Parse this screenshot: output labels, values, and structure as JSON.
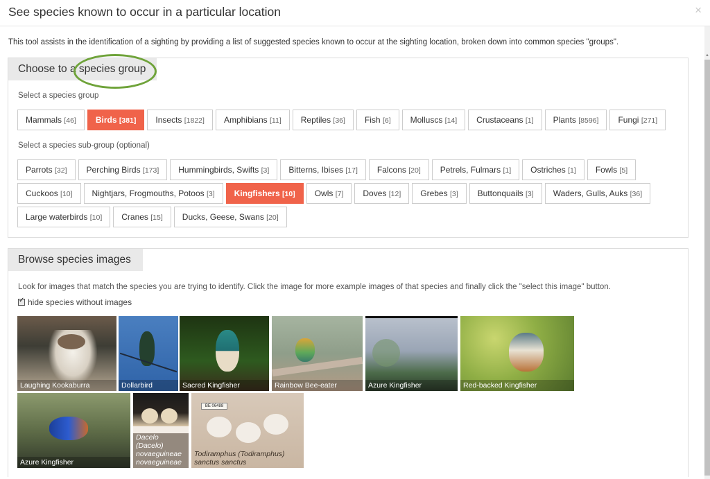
{
  "dialog": {
    "title": "See species known to occur in a particular location",
    "close": "×"
  },
  "intro": "This tool assists in the identification of a sighting by providing a list of suggested species known to occur at the sighting location, broken down into common species \"groups\".",
  "group_panel": {
    "heading": "Choose to a species group",
    "group_label": "Select a species group",
    "groups": [
      {
        "name": "Mammals",
        "count": "[46]"
      },
      {
        "name": "Birds",
        "count": "[381]"
      },
      {
        "name": "Insects",
        "count": "[1822]"
      },
      {
        "name": "Amphibians",
        "count": "[11]"
      },
      {
        "name": "Reptiles",
        "count": "[36]"
      },
      {
        "name": "Fish",
        "count": "[6]"
      },
      {
        "name": "Molluscs",
        "count": "[14]"
      },
      {
        "name": "Crustaceans",
        "count": "[1]"
      },
      {
        "name": "Plants",
        "count": "[8596]"
      },
      {
        "name": "Fungi",
        "count": "[271]"
      }
    ],
    "subgroup_label": "Select a species sub-group (optional)",
    "subgroups_row1": [
      {
        "name": "Parrots",
        "count": "[32]"
      },
      {
        "name": "Perching Birds",
        "count": "[173]"
      },
      {
        "name": "Hummingbirds, Swifts",
        "count": "[3]"
      },
      {
        "name": "Bitterns, Ibises",
        "count": "[17]"
      },
      {
        "name": "Falcons",
        "count": "[20]"
      },
      {
        "name": "Petrels, Fulmars",
        "count": "[1]"
      },
      {
        "name": "Ostriches",
        "count": "[1]"
      },
      {
        "name": "Fowls",
        "count": "[5]"
      }
    ],
    "subgroups_row2": [
      {
        "name": "Cuckoos",
        "count": "[10]"
      },
      {
        "name": "Nightjars, Frogmouths, Potoos",
        "count": "[3]"
      },
      {
        "name": "Kingfishers",
        "count": "[10]"
      },
      {
        "name": "Owls",
        "count": "[7]"
      },
      {
        "name": "Doves",
        "count": "[12]"
      },
      {
        "name": "Grebes",
        "count": "[3]"
      },
      {
        "name": "Buttonquails",
        "count": "[3]"
      },
      {
        "name": "Waders, Gulls, Auks",
        "count": "[36]"
      }
    ],
    "subgroups_row3": [
      {
        "name": "Large waterbirds",
        "count": "[10]"
      },
      {
        "name": "Cranes",
        "count": "[15]"
      },
      {
        "name": "Ducks, Geese, Swans",
        "count": "[20]"
      }
    ],
    "active_group": "Birds",
    "active_subgroup": "Kingfishers"
  },
  "browse_panel": {
    "heading": "Browse species images",
    "help": "Look for images that match the species you are trying to identify. Click the image for more example images of that species and finally click the \"select this image\" button.",
    "hide_label": "hide species without images",
    "hide_checked": true,
    "images": [
      {
        "caption": "Laughing Kookaburra"
      },
      {
        "caption": "Dollarbird"
      },
      {
        "caption": "Sacred Kingfisher"
      },
      {
        "caption": "Rainbow Bee-eater"
      },
      {
        "caption": "Azure Kingfisher"
      },
      {
        "caption": "Red-backed Kingfisher"
      },
      {
        "caption": "Azure Kingfisher"
      },
      {
        "caption": "Dacelo (Dacelo) novaeguineae novaeguineae"
      },
      {
        "caption": "Todiramphus (Todiramphus) sanctus sanctus"
      }
    ],
    "specimen_tag": "BE 06488"
  },
  "colors": {
    "active": "#f0634a",
    "highlight_ring": "#6fa33a",
    "panel_head": "#e9e9e9"
  }
}
